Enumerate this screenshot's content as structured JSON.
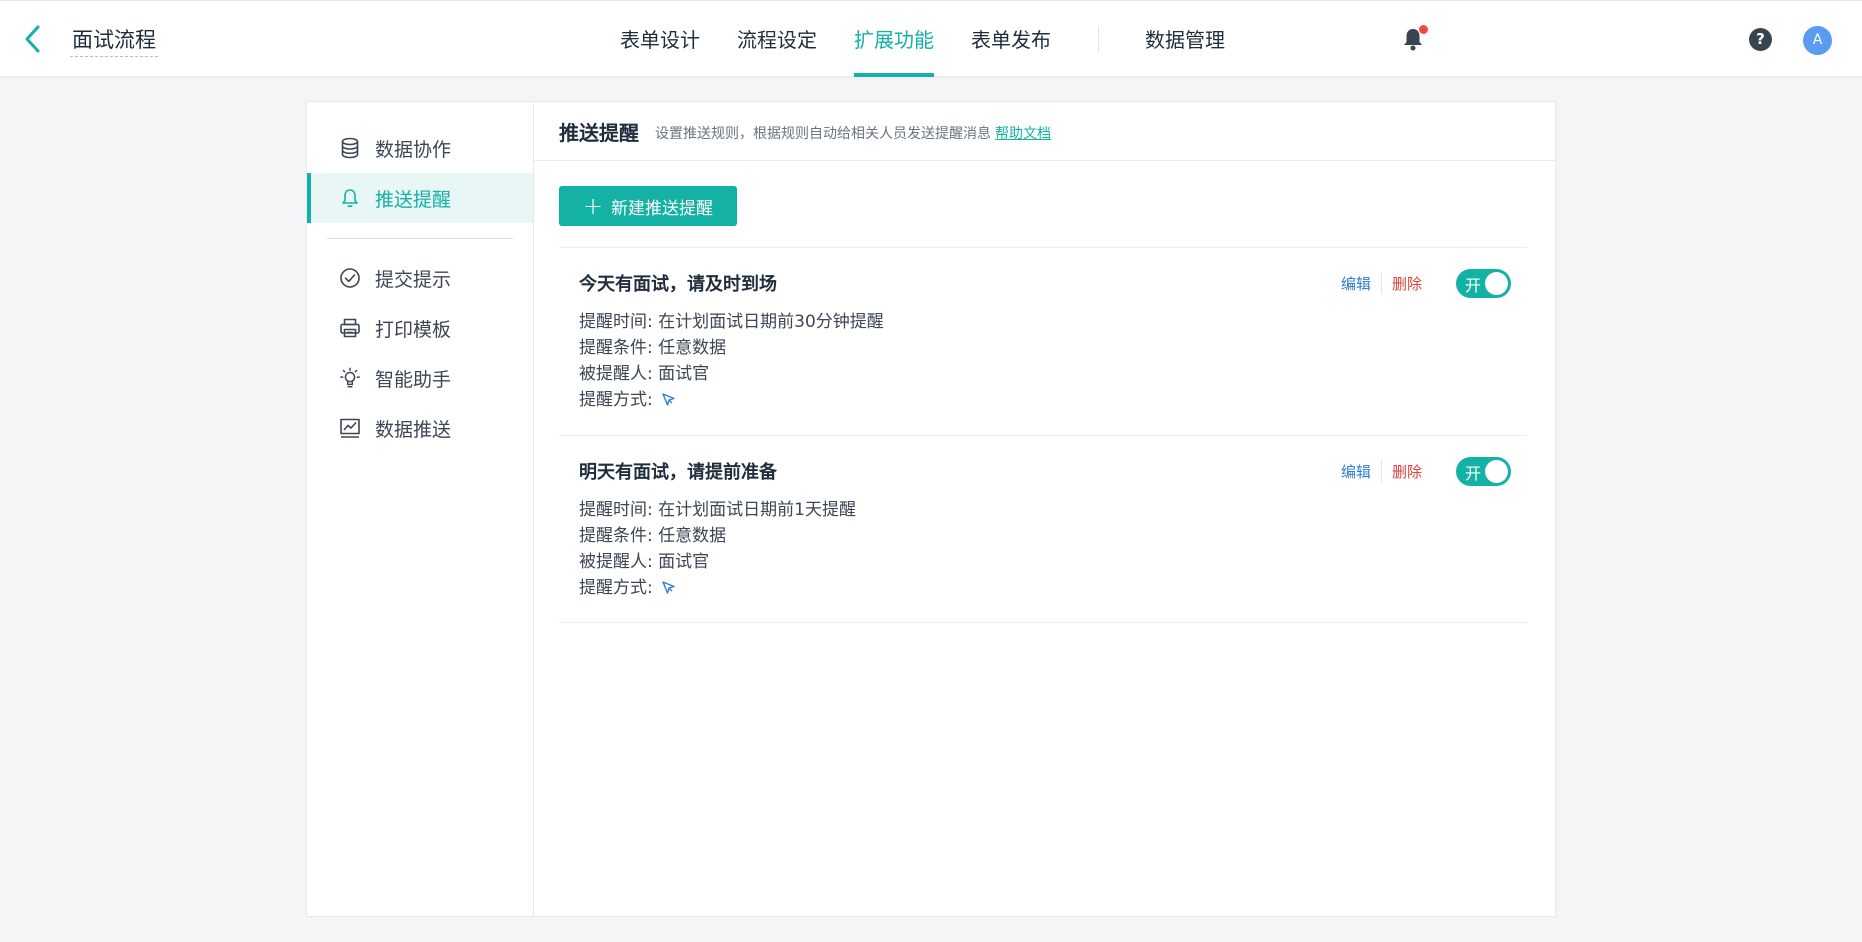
{
  "header": {
    "title": "面试流程",
    "tabs": [
      {
        "label": "表单设计",
        "active": false
      },
      {
        "label": "流程设定",
        "active": false
      },
      {
        "label": "扩展功能",
        "active": true
      },
      {
        "label": "表单发布",
        "active": false
      },
      {
        "label": "数据管理",
        "active": false
      }
    ],
    "avatar_letter": "A",
    "help_glyph": "?",
    "icons": [
      "chevron-left-icon",
      "bell-icon",
      "help-icon"
    ]
  },
  "sidebar": {
    "items": [
      {
        "label": "数据协作",
        "icon": "database-icon",
        "active": false
      },
      {
        "label": "推送提醒",
        "icon": "bell-icon",
        "active": true
      },
      {
        "label": "提交提示",
        "icon": "check-circle-icon",
        "active": false
      },
      {
        "label": "打印模板",
        "icon": "printer-icon",
        "active": false
      },
      {
        "label": "智能助手",
        "icon": "lightbulb-icon",
        "active": false
      },
      {
        "label": "数据推送",
        "icon": "chart-icon",
        "active": false
      }
    ]
  },
  "content": {
    "title": "推送提醒",
    "description": "设置推送规则，根据规则自动给相关人员发送提醒消息",
    "help_link": "帮助文档",
    "new_button": "新建推送提醒",
    "new_button_glyph": "+",
    "rules": [
      {
        "title": "今天有面试，请及时到场",
        "time": "提醒时间: 在计划面试日期前30分钟提醒",
        "condition": "提醒条件: 任意数据",
        "recipient": "被提醒人: 面试官",
        "method": "提醒方式:",
        "method_icon": "send-icon",
        "edit": "编辑",
        "delete": "删除",
        "toggle": "开",
        "enabled": true
      },
      {
        "title": "明天有面试，请提前准备",
        "time": "提醒时间: 在计划面试日期前1天提醒",
        "condition": "提醒条件: 任意数据",
        "recipient": "被提醒人: 面试官",
        "method": "提醒方式:",
        "method_icon": "send-icon",
        "edit": "编辑",
        "delete": "删除",
        "toggle": "开",
        "enabled": true
      }
    ]
  },
  "colors": {
    "accent": "#14b1a5",
    "link_blue": "#2d7fd2",
    "danger_red": "#e0403a",
    "notification_dot": "#f5493d",
    "avatar_blue": "#5a9cf0"
  }
}
